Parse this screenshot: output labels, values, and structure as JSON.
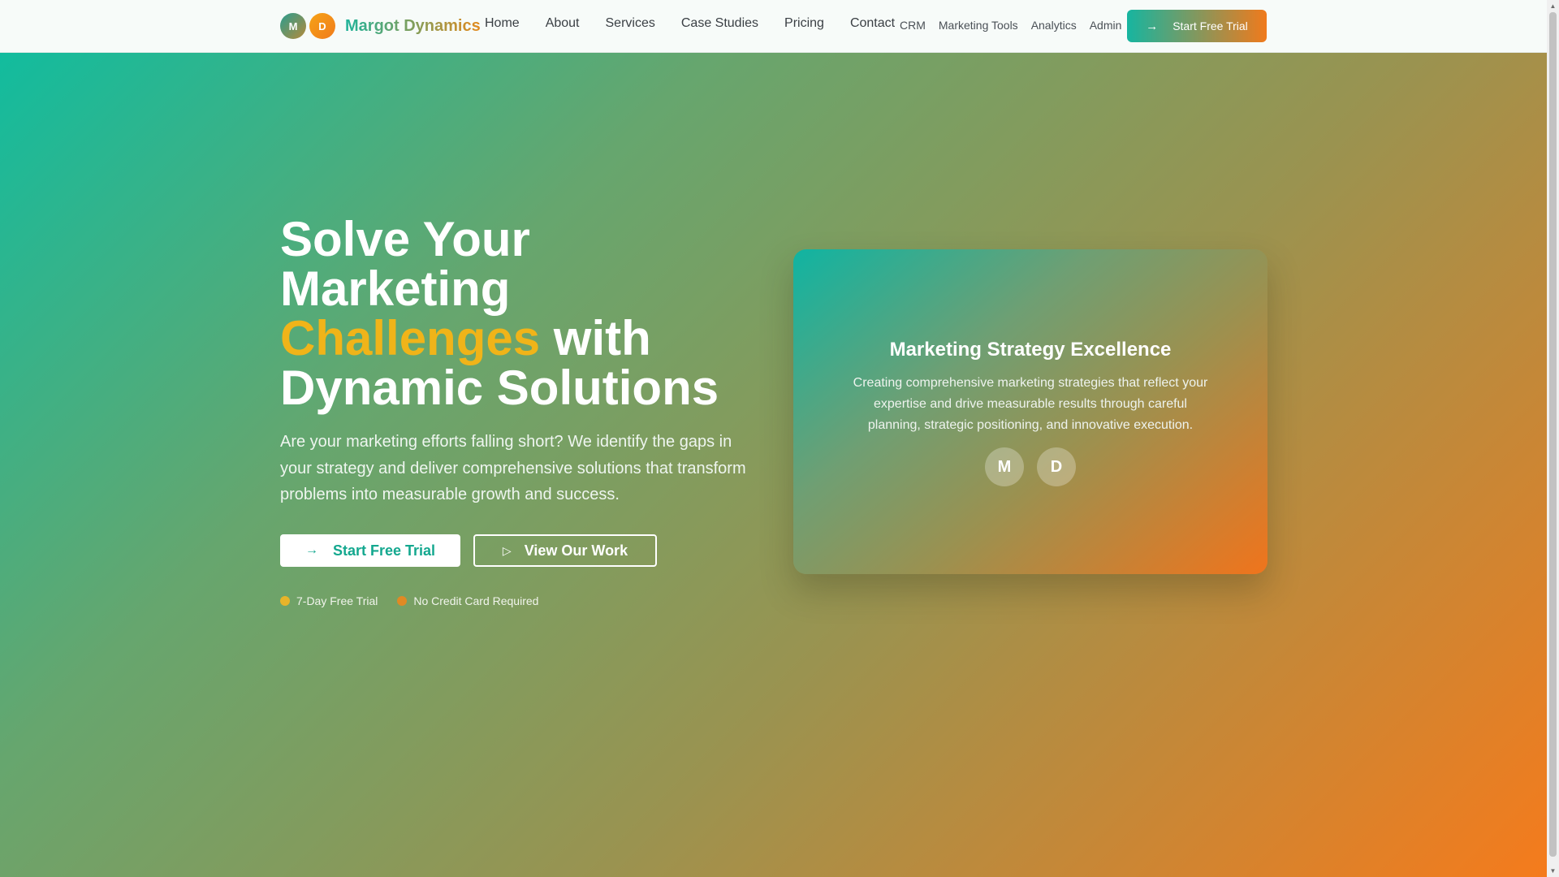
{
  "colors": {
    "accent_teal": "#12bc9e",
    "accent_orange": "#f57b1c",
    "highlight_gold": "#f0b419"
  },
  "header": {
    "logo_initials": [
      "M",
      "D"
    ],
    "brand_name": "Margot Dynamics",
    "nav_main": [
      "Home",
      "About",
      "Services",
      "Case Studies",
      "Pricing",
      "Contact"
    ],
    "nav_secondary": [
      "CRM",
      "Marketing Tools",
      "Analytics",
      "Admin"
    ],
    "cta_label": "Start Free Trial",
    "cta_icon": "arrow-right-icon"
  },
  "hero": {
    "title_part1": "Solve Your Marketing",
    "title_highlight": "Challenges",
    "title_part2": "with Dynamic Solutions",
    "subtitle": "Are your marketing efforts falling short? We identify the gaps in your strategy and deliver comprehensive solutions that transform problems into measurable growth and success.",
    "primary_button": "Start Free Trial",
    "primary_icon": "arrow-right-icon",
    "secondary_button": "View Our Work",
    "secondary_icon": "play-icon",
    "badges": [
      {
        "label": "7-Day Free Trial",
        "color": "#e7b42a"
      },
      {
        "label": "No Credit Card Required",
        "color": "#e08a24"
      }
    ]
  },
  "card": {
    "title": "Marketing Strategy Excellence",
    "text": "Creating comprehensive marketing strategies that reflect your expertise and drive measurable results through careful planning, strategic positioning, and innovative execution.",
    "avatars": [
      "M",
      "D"
    ]
  }
}
